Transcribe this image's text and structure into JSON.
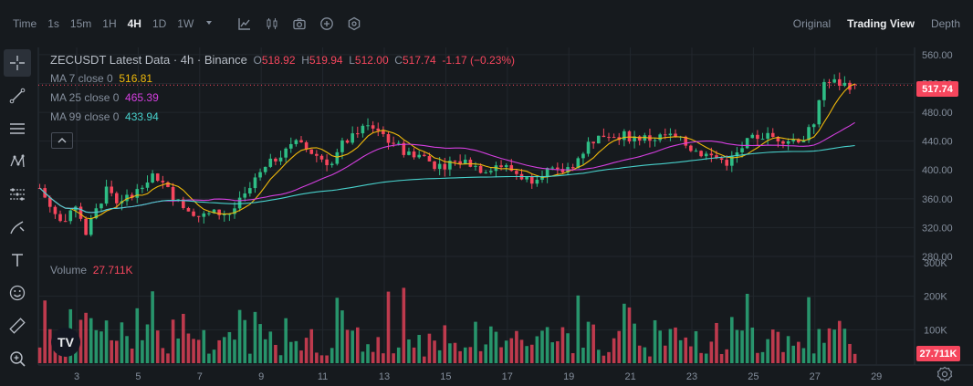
{
  "header": {
    "time_label": "Time",
    "timeframes": [
      {
        "label": "1s",
        "active": false
      },
      {
        "label": "15m",
        "active": false
      },
      {
        "label": "1H",
        "active": false
      },
      {
        "label": "4H",
        "active": true
      },
      {
        "label": "1D",
        "active": false
      },
      {
        "label": "1W",
        "active": false
      }
    ],
    "views": [
      {
        "label": "Original",
        "active": false
      },
      {
        "label": "Trading View",
        "active": true
      },
      {
        "label": "Depth",
        "active": false
      }
    ]
  },
  "legend": {
    "symbol": "ZECUSDT Latest Data · 4h · Binance",
    "o_label": "O",
    "o_value": "518.92",
    "h_label": "H",
    "h_value": "519.94",
    "l_label": "L",
    "l_value": "512.00",
    "c_label": "C",
    "c_value": "517.74",
    "change": "-1.17 (−0.23%)",
    "ma": [
      {
        "label": "MA 7 close 0",
        "value": "516.81",
        "color": "#f0b90b"
      },
      {
        "label": "MA 25 close 0",
        "value": "465.39",
        "color": "#d53fe0"
      },
      {
        "label": "MA 99 close 0",
        "value": "433.94",
        "color": "#48d1cc"
      }
    ]
  },
  "volume_legend": {
    "label": "Volume",
    "value": "27.711K"
  },
  "price_axis": {
    "ticks": [
      "560.00",
      "520.00",
      "480.00",
      "440.00",
      "400.00",
      "360.00",
      "320.00",
      "280.00"
    ],
    "current": "517.74"
  },
  "volume_axis": {
    "ticks": [
      "300K",
      "200K",
      "100K"
    ],
    "current": "27.711K"
  },
  "time_axis": {
    "ticks": [
      "3",
      "5",
      "7",
      "9",
      "11",
      "13",
      "15",
      "17",
      "19",
      "21",
      "23",
      "25",
      "27",
      "29"
    ]
  },
  "colors": {
    "up": "#2ebd85",
    "down": "#f6465d",
    "bg": "#161a1e",
    "grid": "#22272d"
  },
  "logo_text": "TV",
  "chart_data": {
    "type": "candlestick",
    "pair": "ZECUSDT",
    "interval": "4h",
    "price_range": [
      280,
      570
    ],
    "volume_range": [
      0,
      300000
    ],
    "close_path": [
      {
        "day": 1.8,
        "close": 375
      },
      {
        "day": 2.2,
        "close": 345
      },
      {
        "day": 2.6,
        "close": 320
      },
      {
        "day": 3.0,
        "close": 355
      },
      {
        "day": 3.3,
        "close": 312
      },
      {
        "day": 3.6,
        "close": 340
      },
      {
        "day": 4.0,
        "close": 378
      },
      {
        "day": 4.4,
        "close": 350
      },
      {
        "day": 4.8,
        "close": 368
      },
      {
        "day": 5.2,
        "close": 385
      },
      {
        "day": 5.5,
        "close": 395
      },
      {
        "day": 6.0,
        "close": 370
      },
      {
        "day": 6.5,
        "close": 352
      },
      {
        "day": 7.0,
        "close": 335
      },
      {
        "day": 7.5,
        "close": 340
      },
      {
        "day": 8.0,
        "close": 340
      },
      {
        "day": 8.5,
        "close": 365
      },
      {
        "day": 9.0,
        "close": 395
      },
      {
        "day": 9.5,
        "close": 418
      },
      {
        "day": 10.0,
        "close": 440
      },
      {
        "day": 10.5,
        "close": 428
      },
      {
        "day": 11.0,
        "close": 415
      },
      {
        "day": 11.3,
        "close": 408
      },
      {
        "day": 11.7,
        "close": 440
      },
      {
        "day": 12.2,
        "close": 458
      },
      {
        "day": 12.7,
        "close": 460
      },
      {
        "day": 13.2,
        "close": 440
      },
      {
        "day": 13.7,
        "close": 425
      },
      {
        "day": 14.2,
        "close": 420
      },
      {
        "day": 14.7,
        "close": 405
      },
      {
        "day": 15.2,
        "close": 410
      },
      {
        "day": 15.7,
        "close": 412
      },
      {
        "day": 16.2,
        "close": 400
      },
      {
        "day": 16.7,
        "close": 408
      },
      {
        "day": 17.2,
        "close": 398
      },
      {
        "day": 17.7,
        "close": 385
      },
      {
        "day": 18.2,
        "close": 400
      },
      {
        "day": 18.7,
        "close": 395
      },
      {
        "day": 19.2,
        "close": 410
      },
      {
        "day": 19.7,
        "close": 440
      },
      {
        "day": 20.2,
        "close": 450
      },
      {
        "day": 20.7,
        "close": 448
      },
      {
        "day": 21.2,
        "close": 445
      },
      {
        "day": 21.7,
        "close": 443
      },
      {
        "day": 22.2,
        "close": 448
      },
      {
        "day": 22.7,
        "close": 438
      },
      {
        "day": 23.2,
        "close": 425
      },
      {
        "day": 23.7,
        "close": 418
      },
      {
        "day": 24.2,
        "close": 410
      },
      {
        "day": 24.7,
        "close": 435
      },
      {
        "day": 25.2,
        "close": 448
      },
      {
        "day": 25.7,
        "close": 445
      },
      {
        "day": 26.2,
        "close": 442
      },
      {
        "day": 26.7,
        "close": 445
      },
      {
        "day": 27.0,
        "close": 470
      },
      {
        "day": 27.3,
        "close": 520
      },
      {
        "day": 27.6,
        "close": 522
      },
      {
        "day": 28.0,
        "close": 518
      },
      {
        "day": 28.4,
        "close": 517.74
      }
    ]
  }
}
